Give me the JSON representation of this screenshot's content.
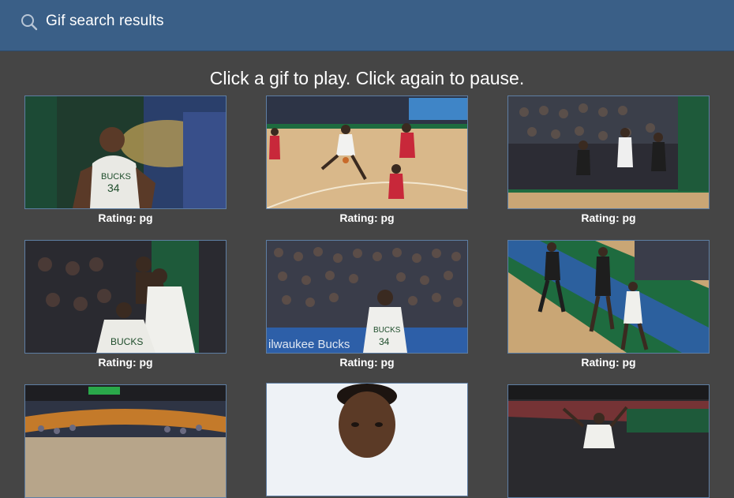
{
  "header": {
    "title": "Gif search results",
    "icon": "search-icon"
  },
  "instructions": "Click a gif to play. Click again to pause.",
  "gifs": [
    {
      "rating": "Rating: pg",
      "scene": "player-closeup-bucks-34"
    },
    {
      "rating": "Rating: pg",
      "scene": "court-dribble"
    },
    {
      "rating": "Rating: pg",
      "scene": "court-crowd-baseline"
    },
    {
      "rating": "Rating: pg",
      "scene": "players-bench-reaction"
    },
    {
      "rating": "Rating: pg",
      "scene": "crowd-player-bucks-34"
    },
    {
      "rating": "Rating: pg",
      "scene": "court-referee-players"
    },
    {
      "rating": "",
      "scene": "arena-wide"
    },
    {
      "rating": "",
      "scene": "portrait"
    },
    {
      "rating": "",
      "scene": "arena-celebration"
    }
  ],
  "colors": {
    "header": "#3a5f87",
    "background": "#454545",
    "thumb_border": "#5e7ea3"
  }
}
